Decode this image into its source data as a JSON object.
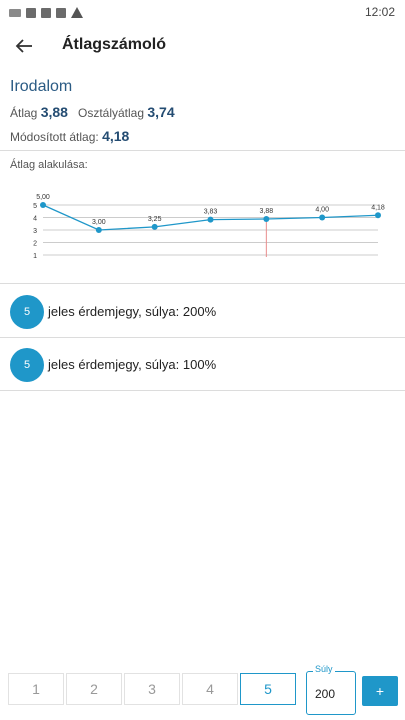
{
  "status_bar": {
    "time": "12:02"
  },
  "app_bar": {
    "title": "Átlagszámoló"
  },
  "subject": {
    "name": "Irodalom",
    "avg_label": "Átlag",
    "avg_value": "3,88",
    "class_avg_label": "Osztályátlag",
    "class_avg_value": "3,74",
    "modified_label": "Módosított átlag:",
    "modified_value": "4,18"
  },
  "chart_label": "Átlag alakulása:",
  "chart_data": {
    "type": "line",
    "x": [
      1,
      2,
      3,
      4,
      5,
      6,
      7
    ],
    "values": [
      5.0,
      3.0,
      3.25,
      3.83,
      3.88,
      4.0,
      4.18
    ],
    "data_labels": [
      "5,00",
      "3,00",
      "3,25",
      "3,83",
      "3,88",
      "4,00",
      "4,18"
    ],
    "y_ticks": [
      "1",
      "2",
      "3",
      "4",
      "5"
    ],
    "ylim": [
      1,
      5
    ],
    "marker_index": 4,
    "colors": {
      "line": "#1f97c9",
      "marker": "#e88c8c",
      "grid": "#cccccc"
    }
  },
  "grades": [
    {
      "value": "5",
      "text": "jeles érdemjegy, súlya: 200%"
    },
    {
      "value": "5",
      "text": "jeles érdemjegy, súlya: 100%"
    }
  ],
  "bottom_bar": {
    "grade_buttons": [
      "1",
      "2",
      "3",
      "4",
      "5"
    ],
    "selected": "5",
    "weight_label": "Súly",
    "weight_value": "200",
    "add_label": "+"
  },
  "colors": {
    "accent": "#1f97c9",
    "subject": "#2b5b84"
  }
}
